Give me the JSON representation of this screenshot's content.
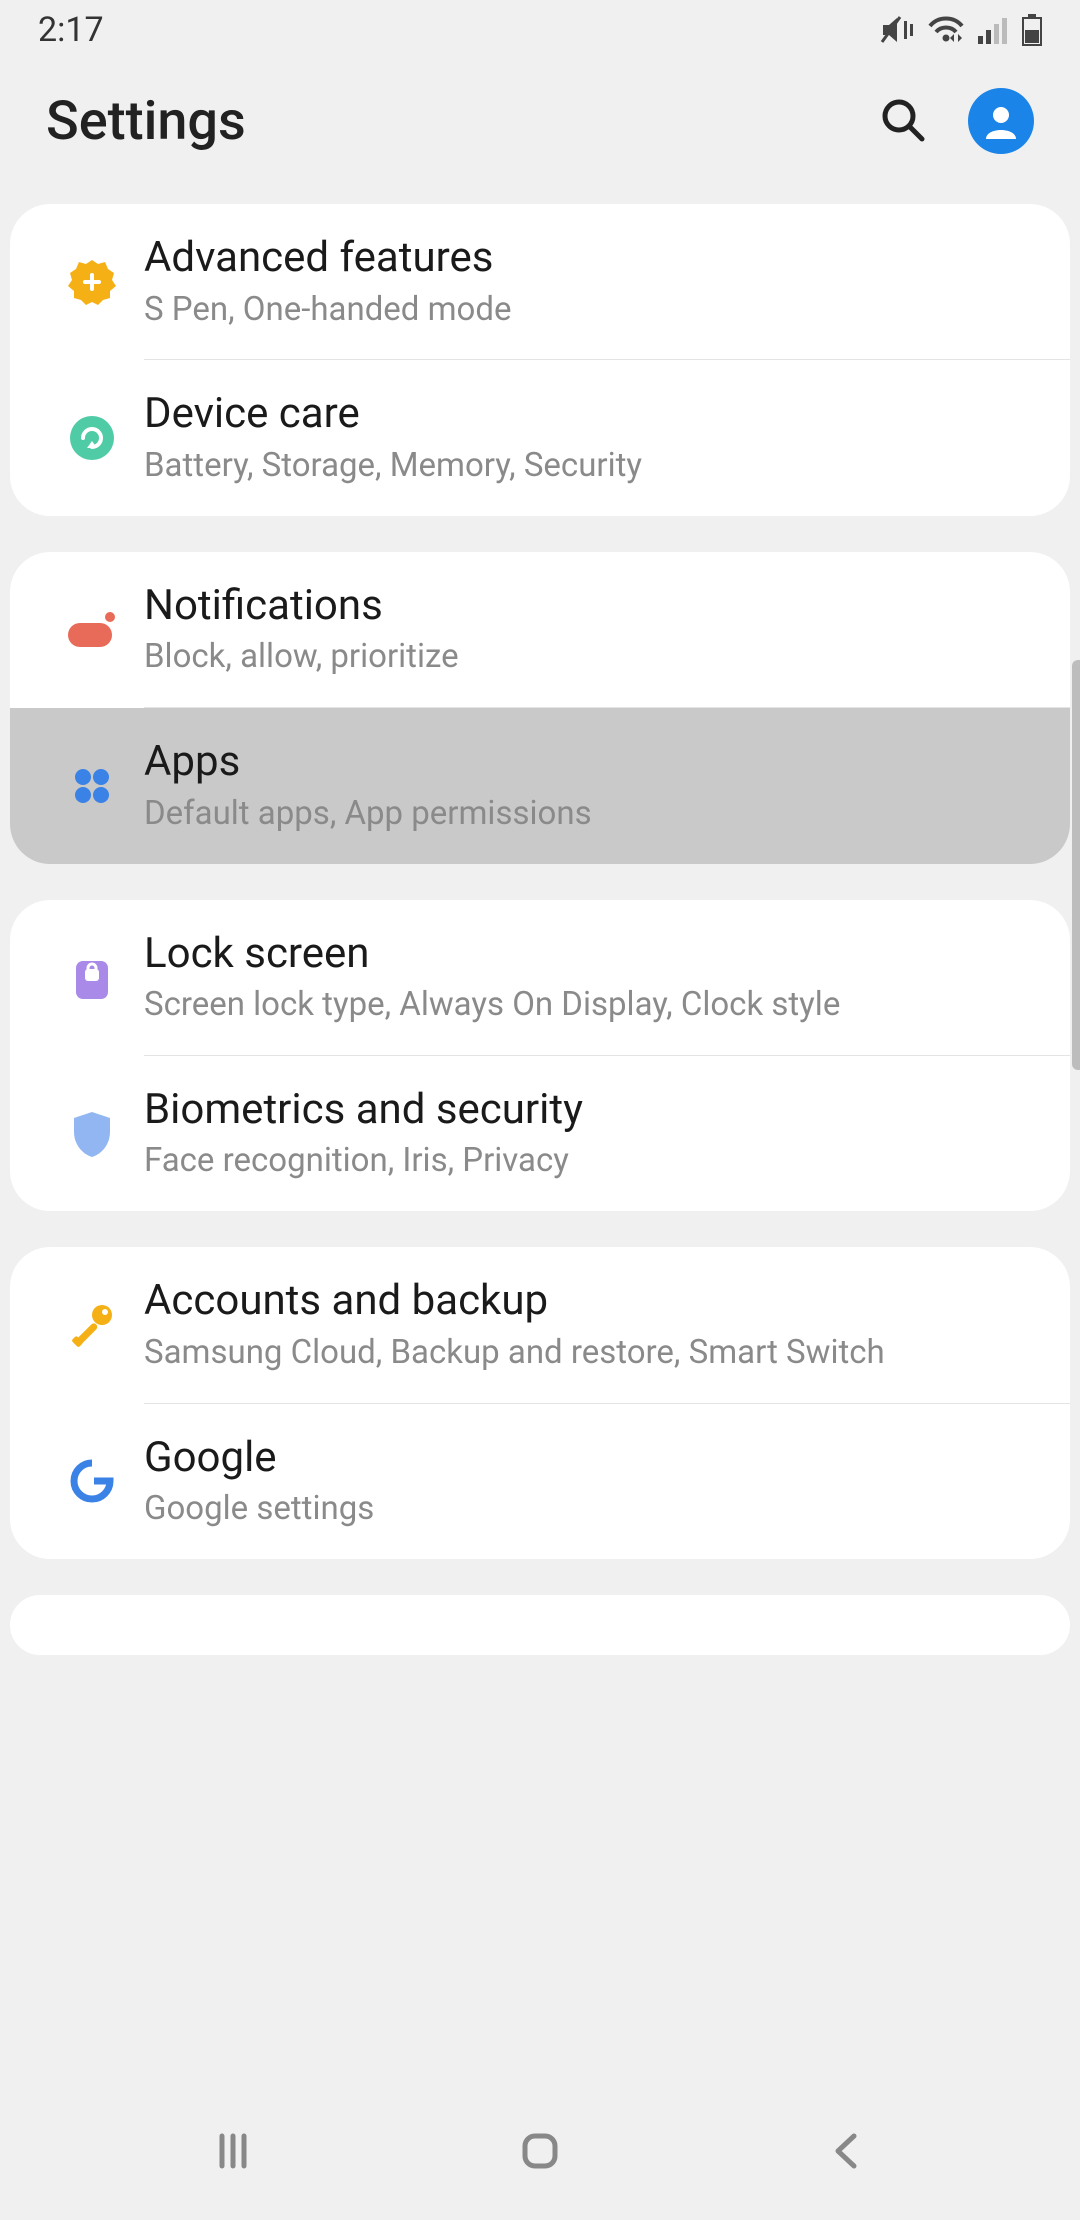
{
  "status": {
    "time": "2:17"
  },
  "header": {
    "title": "Settings"
  },
  "groups": [
    {
      "items": [
        {
          "id": "advanced-features",
          "title": "Advanced features",
          "sub": "S Pen, One-handed mode"
        },
        {
          "id": "device-care",
          "title": "Device care",
          "sub": "Battery, Storage, Memory, Security"
        }
      ]
    },
    {
      "items": [
        {
          "id": "notifications",
          "title": "Notifications",
          "sub": "Block, allow, prioritize"
        },
        {
          "id": "apps",
          "title": "Apps",
          "sub": "Default apps, App permissions",
          "pressed": true
        }
      ]
    },
    {
      "items": [
        {
          "id": "lock-screen",
          "title": "Lock screen",
          "sub": "Screen lock type, Always On Display, Clock style"
        },
        {
          "id": "biometrics",
          "title": "Biometrics and security",
          "sub": "Face recognition, Iris, Privacy"
        }
      ]
    },
    {
      "items": [
        {
          "id": "accounts-backup",
          "title": "Accounts and backup",
          "sub": "Samsung Cloud, Backup and restore, Smart Switch"
        },
        {
          "id": "google",
          "title": "Google",
          "sub": "Google settings"
        }
      ]
    }
  ]
}
